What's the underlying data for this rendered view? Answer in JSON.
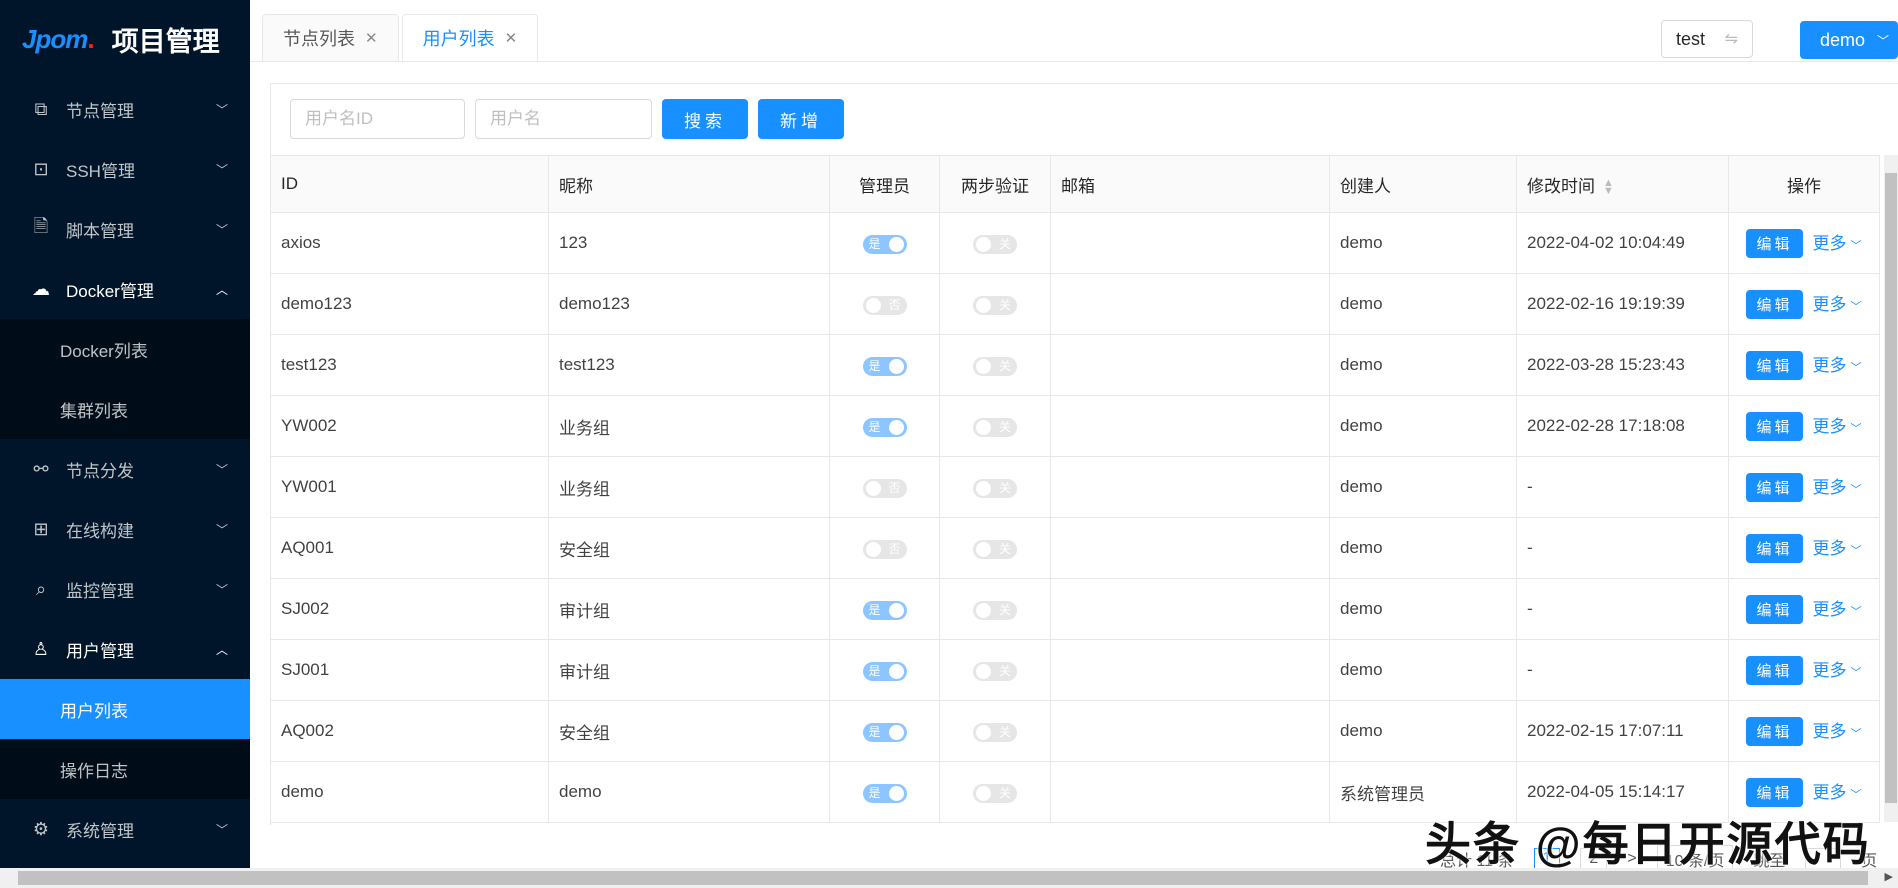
{
  "brand": {
    "logo": "Jpom",
    "title": "项目管理"
  },
  "sidebar": {
    "items": [
      {
        "label": "节点管理",
        "icon": "⧉"
      },
      {
        "label": "SSH管理",
        "icon": "⊡"
      },
      {
        "label": "脚本管理",
        "icon": "🗎"
      },
      {
        "label": "Docker管理",
        "icon": "☁",
        "sub": [
          "Docker列表",
          "集群列表"
        ]
      },
      {
        "label": "节点分发",
        "icon": "⚯"
      },
      {
        "label": "在线构建",
        "icon": "⊞"
      },
      {
        "label": "监控管理",
        "icon": "⌕"
      },
      {
        "label": "用户管理",
        "icon": "♙",
        "sub": [
          "用户列表",
          "操作日志"
        ]
      },
      {
        "label": "系统管理",
        "icon": "⚙"
      }
    ]
  },
  "tabs": [
    {
      "label": "节点列表"
    },
    {
      "label": "用户列表"
    }
  ],
  "header": {
    "workspace": "test",
    "user": "demo"
  },
  "search": {
    "id_placeholder": "用户名ID",
    "name_placeholder": "用户名",
    "search_label": "搜索",
    "add_label": "新增"
  },
  "table": {
    "headers": [
      "ID",
      "昵称",
      "管理员",
      "两步验证",
      "邮箱",
      "创建人",
      "修改时间",
      "操作"
    ],
    "edit_label": "编辑",
    "more_label": "更多",
    "rows": [
      {
        "id": "axios",
        "name": "123",
        "admin": true,
        "admin_text": "是",
        "tfa_text": "关",
        "email": "",
        "creator": "demo",
        "time": "2022-04-02 10:04:49"
      },
      {
        "id": "demo123",
        "name": "demo123",
        "admin": false,
        "admin_text": "否",
        "tfa_text": "关",
        "email": "",
        "creator": "demo",
        "time": "2022-02-16 19:19:39"
      },
      {
        "id": "test123",
        "name": "test123",
        "admin": true,
        "admin_text": "是",
        "tfa_text": "关",
        "email": "",
        "creator": "demo",
        "time": "2022-03-28 15:23:43"
      },
      {
        "id": "YW002",
        "name": "业务组",
        "admin": true,
        "admin_text": "是",
        "tfa_text": "关",
        "email": "",
        "creator": "demo",
        "time": "2022-02-28 17:18:08"
      },
      {
        "id": "YW001",
        "name": "业务组",
        "admin": false,
        "admin_text": "否",
        "tfa_text": "关",
        "email": "",
        "creator": "demo",
        "time": "-"
      },
      {
        "id": "AQ001",
        "name": "安全组",
        "admin": false,
        "admin_text": "否",
        "tfa_text": "关",
        "email": "",
        "creator": "demo",
        "time": "-"
      },
      {
        "id": "SJ002",
        "name": "审计组",
        "admin": true,
        "admin_text": "是",
        "tfa_text": "关",
        "email": "",
        "creator": "demo",
        "time": "-"
      },
      {
        "id": "SJ001",
        "name": "审计组",
        "admin": true,
        "admin_text": "是",
        "tfa_text": "关",
        "email": "",
        "creator": "demo",
        "time": "-"
      },
      {
        "id": "AQ002",
        "name": "安全组",
        "admin": true,
        "admin_text": "是",
        "tfa_text": "关",
        "email": "",
        "creator": "demo",
        "time": "2022-02-15 17:07:11"
      },
      {
        "id": "demo",
        "name": "demo",
        "admin": true,
        "admin_text": "是",
        "tfa_text": "关",
        "email": "",
        "creator": "系统管理员",
        "time": "2022-04-05 15:14:17"
      }
    ]
  },
  "pagination": {
    "total": "总计 11 条",
    "pages": [
      "1",
      "2"
    ],
    "next": ">",
    "size": "10 条/页",
    "jump": "跳至",
    "page_suffix": "页"
  },
  "watermark": "头条 @每日开源代码"
}
